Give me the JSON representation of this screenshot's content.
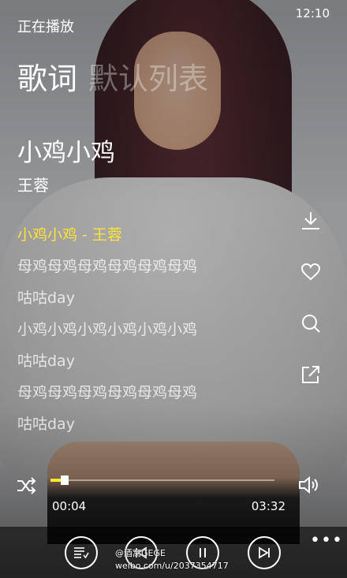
{
  "status_bar": {
    "time": "12:10"
  },
  "header": {
    "title": "正在播放"
  },
  "tabs": [
    {
      "label": "歌词",
      "active": true
    },
    {
      "label": "默认列表",
      "active": false
    }
  ],
  "song": {
    "title": "小鸡小鸡",
    "artist": "王蓉"
  },
  "lyrics": [
    "小鸡小鸡 - 王蓉",
    "母鸡母鸡母鸡母鸡母鸡母鸡",
    "咕咕day",
    "小鸡小鸡小鸡小鸡小鸡小鸡",
    "咕咕day",
    "母鸡母鸡母鸡母鸡母鸡母鸡",
    "咕咕day"
  ],
  "player": {
    "elapsed": "00:04",
    "total": "03:32",
    "progress_fraction": 0.019
  },
  "side_icons": [
    "download-icon",
    "heart-icon",
    "search-icon",
    "share-icon"
  ],
  "controls": [
    "playlist-icon",
    "previous-icon",
    "pause-icon",
    "next-icon"
  ],
  "watermark": {
    "line1": "@酒窝GEGE",
    "line2": "weibo.com/u/2037354717"
  },
  "colors": {
    "accent": "#ffe23a",
    "text": "#ffffff"
  }
}
